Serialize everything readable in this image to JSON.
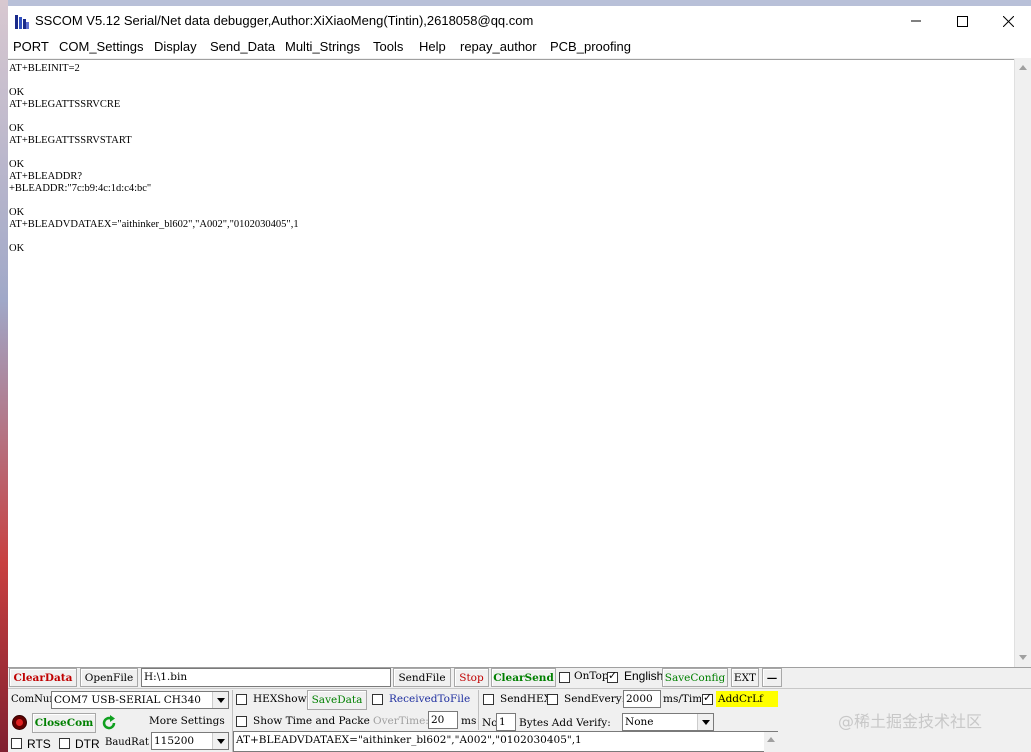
{
  "window": {
    "title": "SSCOM V5.12 Serial/Net data debugger,Author:XiXiaoMeng(Tintin),2618058@qq.com"
  },
  "menu": [
    "PORT",
    "COM_Settings",
    "Display",
    "Send_Data",
    "Multi_Strings",
    "Tools",
    "Help",
    "repay_author",
    "PCB_proofing"
  ],
  "receive_text": "AT+BLEINIT=2\n\nOK\nAT+BLEGATTSSRVCRE\n\nOK\nAT+BLEGATTSSRVSTART\n\nOK\nAT+BLEADDR?\n+BLEADDR:\"7c:b9:4c:1d:c4:bc\"\n\nOK\nAT+BLEADVDATAEX=\"aithinker_bl602\",\"A002\",\"0102030405\",1\n\nOK",
  "toolbar": {
    "clear_data": "ClearData",
    "open_file": "OpenFile",
    "file_path": "H:\\1.bin",
    "send_file": "SendFile",
    "stop": "Stop",
    "clear_send": "ClearSend",
    "on_top": "OnTop",
    "english": "English",
    "save_config": "SaveConfig",
    "ext": "EXT",
    "collapse": "—"
  },
  "port": {
    "comnum_label": "ComNum",
    "comnum_value": "COM7 USB-SERIAL CH340",
    "close_com": "CloseCom",
    "more_settings": "More Settings",
    "rts": "RTS",
    "dtr": "DTR",
    "baud_label": "BaudRat",
    "baud_value": "115200"
  },
  "display": {
    "hex_show": "HEXShow",
    "save_data": "SaveData",
    "received_to_file": "ReceivedToFile",
    "show_time": "Show Time and Packe",
    "overtime_label": "OverTime:",
    "overtime_value": "20",
    "ms": "ms"
  },
  "send": {
    "send_hex": "SendHEX",
    "send_every": "SendEvery:",
    "interval_value": "2000",
    "interval_unit": "ms/Tim",
    "add_crlf": "AddCrLf",
    "no_label": "No",
    "no_value": "1",
    "bytes_verify": "Bytes Add Verify:",
    "verify_value": "None",
    "send_text": "AT+BLEADVDATAEX=\"aithinker_bl602\",\"A002\",\"0102030405\",1"
  },
  "colors": {
    "accent_red": "#c00000",
    "accent_green": "#008000",
    "highlight_yellow": "#ffff00"
  },
  "watermark": "@稀土掘金技术社区"
}
